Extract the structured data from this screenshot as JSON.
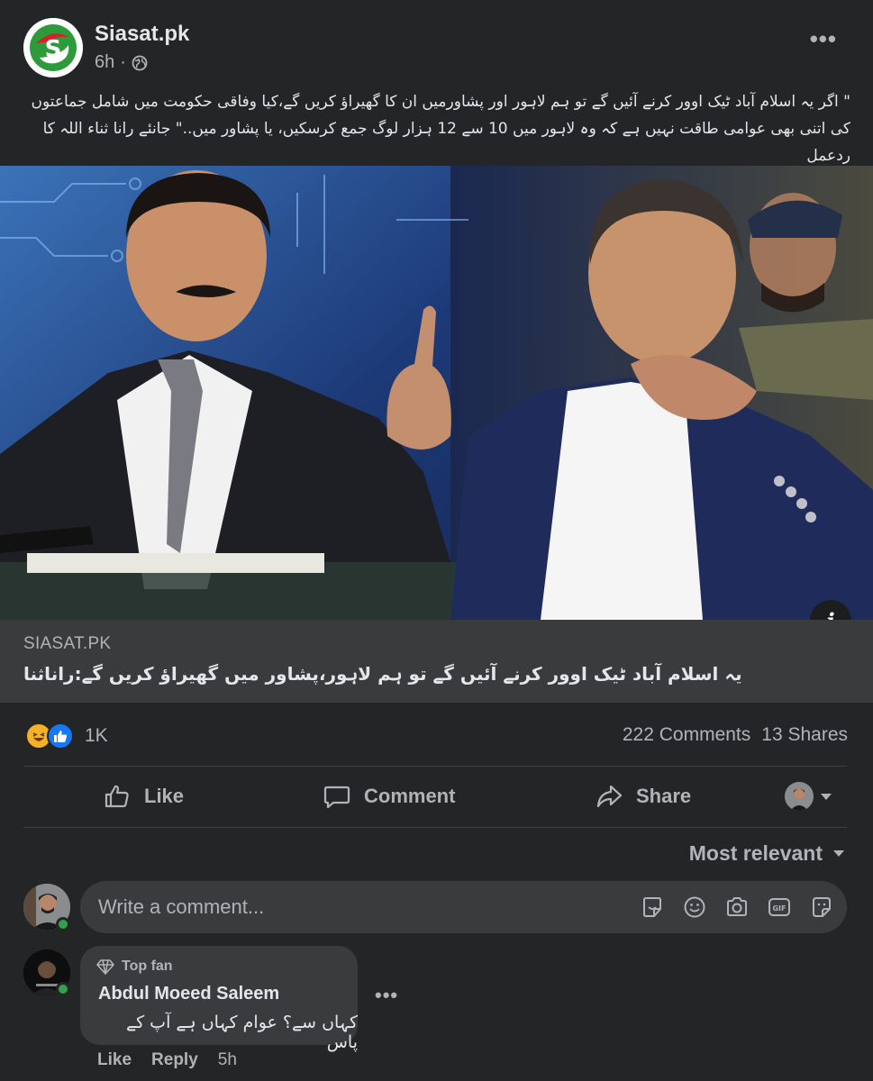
{
  "post": {
    "page_name": "Siasat.pk",
    "time": "6h",
    "dot": "·",
    "caption": "\" اگر یہ اسلام آباد ٹیک اوور کرنے آئیں گے تو ہم لاہور اور پشاورمیں ان کا گھیراؤ کریں گے،کیا وفاقی حکومت میں شامل جماعتوں کی اتنی بھی عوامی طاقت نہیں ہے کہ وہ لاہور میں 10 سے 12 ہزار لوگ جمع کرسکیں، یا پشاور میں..\" جانئے رانا ثناء اللہ کا ردعمل"
  },
  "link": {
    "domain": "SIASAT.PK",
    "title": "یہ اسلام آباد ٹیک اوور کرنے آئیں گے تو ہم لاہور،پشاور میں گھیراؤ کریں گے:راناثنا"
  },
  "stats": {
    "reactions": "1K",
    "comments": "222 Comments",
    "shares": "13 Shares"
  },
  "actions": {
    "like": "Like",
    "comment": "Comment",
    "share": "Share"
  },
  "sort": {
    "label": "Most relevant"
  },
  "composer": {
    "placeholder": "Write a comment..."
  },
  "comment": {
    "badge": "Top fan",
    "author": "Abdul Moeed Saleem",
    "text": "کہاں سے؟ عوام کہاں ہے آپ کے پاس",
    "like": "Like",
    "reply": "Reply",
    "time": "5h"
  },
  "icons": {
    "page_logo": "siasat-logo",
    "audience": "globe-icon",
    "more": "more-icon",
    "info": "info-icon",
    "haha": "haha-reaction-icon",
    "like_reaction": "like-reaction-icon",
    "like": "thumbs-up-icon",
    "comment": "comment-bubble-icon",
    "share": "share-arrow-icon",
    "sticker": "sticker-icon",
    "emoji": "emoji-icon",
    "camera": "camera-icon",
    "gif": "gif-icon",
    "avatar_sticker": "avatar-sticker-icon",
    "top_fan": "diamond-icon"
  },
  "colors": {
    "background": "#242526",
    "surface": "#3a3b3c",
    "text_primary": "#e4e6eb",
    "text_secondary": "#b0b3b8",
    "like_blue": "#1877f2",
    "haha_yellow": "#f7b125",
    "online_green": "#31a24c"
  }
}
